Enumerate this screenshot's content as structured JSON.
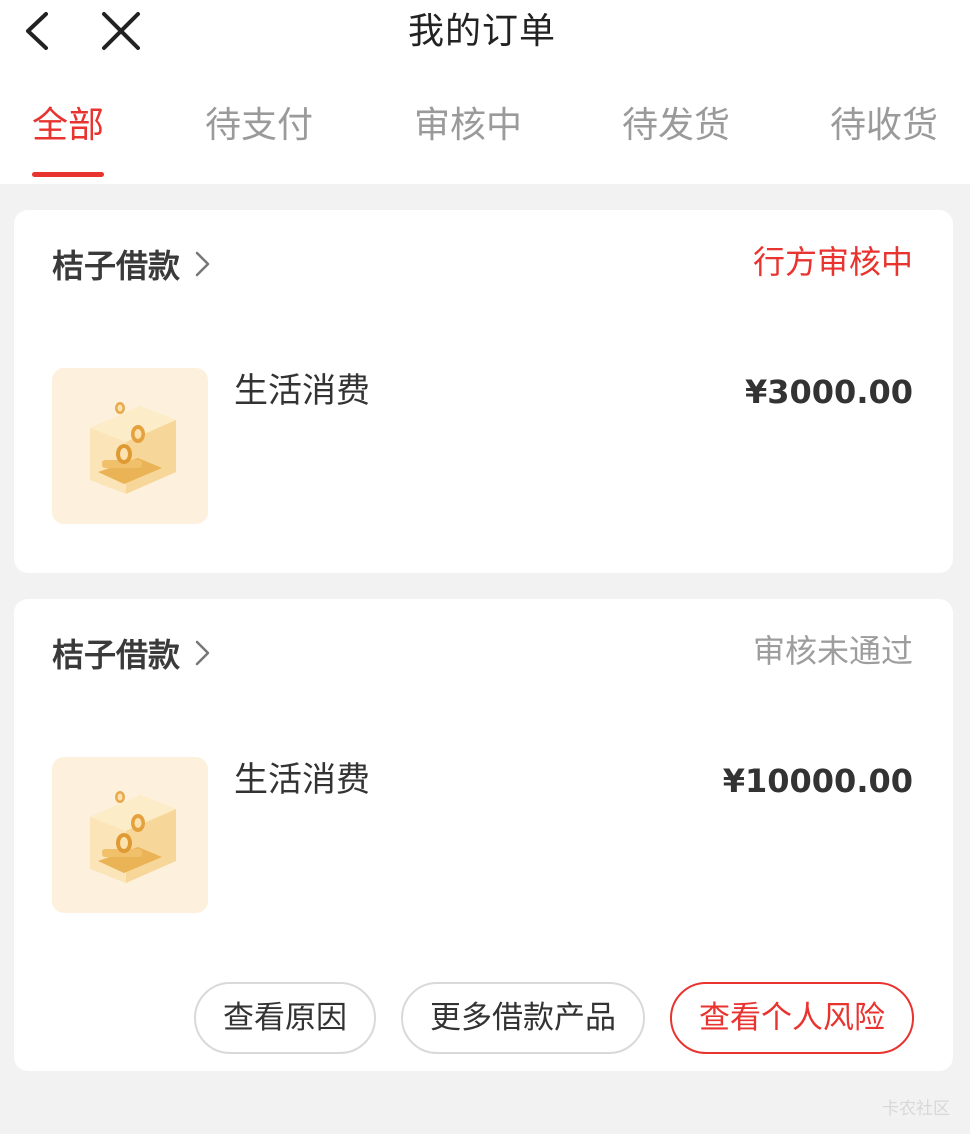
{
  "header": {
    "title": "我的订单",
    "back_icon": "chevron-left-icon",
    "close_icon": "close-icon"
  },
  "tabs": [
    {
      "label": "全部",
      "active": true
    },
    {
      "label": "待支付",
      "active": false
    },
    {
      "label": "审核中",
      "active": false
    },
    {
      "label": "待发货",
      "active": false
    },
    {
      "label": "待收货",
      "active": false
    }
  ],
  "colors": {
    "accent": "#e8332f",
    "page_bg": "#f2f2f2",
    "card_bg": "#ffffff",
    "muted_text": "#9d9d9d",
    "thumb_bg": "#fdf1de"
  },
  "orders": [
    {
      "merchant": "桔子借款",
      "status": "行方审核中",
      "status_color": "#e8332f",
      "product": "生活消费",
      "price": "¥3000.00",
      "thumb_icon": "coin-box-icon"
    },
    {
      "merchant": "桔子借款",
      "status": "审核未通过",
      "status_color": "#9d9d9d",
      "product": "生活消费",
      "price": "¥10000.00",
      "thumb_icon": "coin-box-icon",
      "actions": [
        "查看原因",
        "更多借款产品",
        "查看个人风险"
      ]
    }
  ],
  "watermark": "卡农社区"
}
